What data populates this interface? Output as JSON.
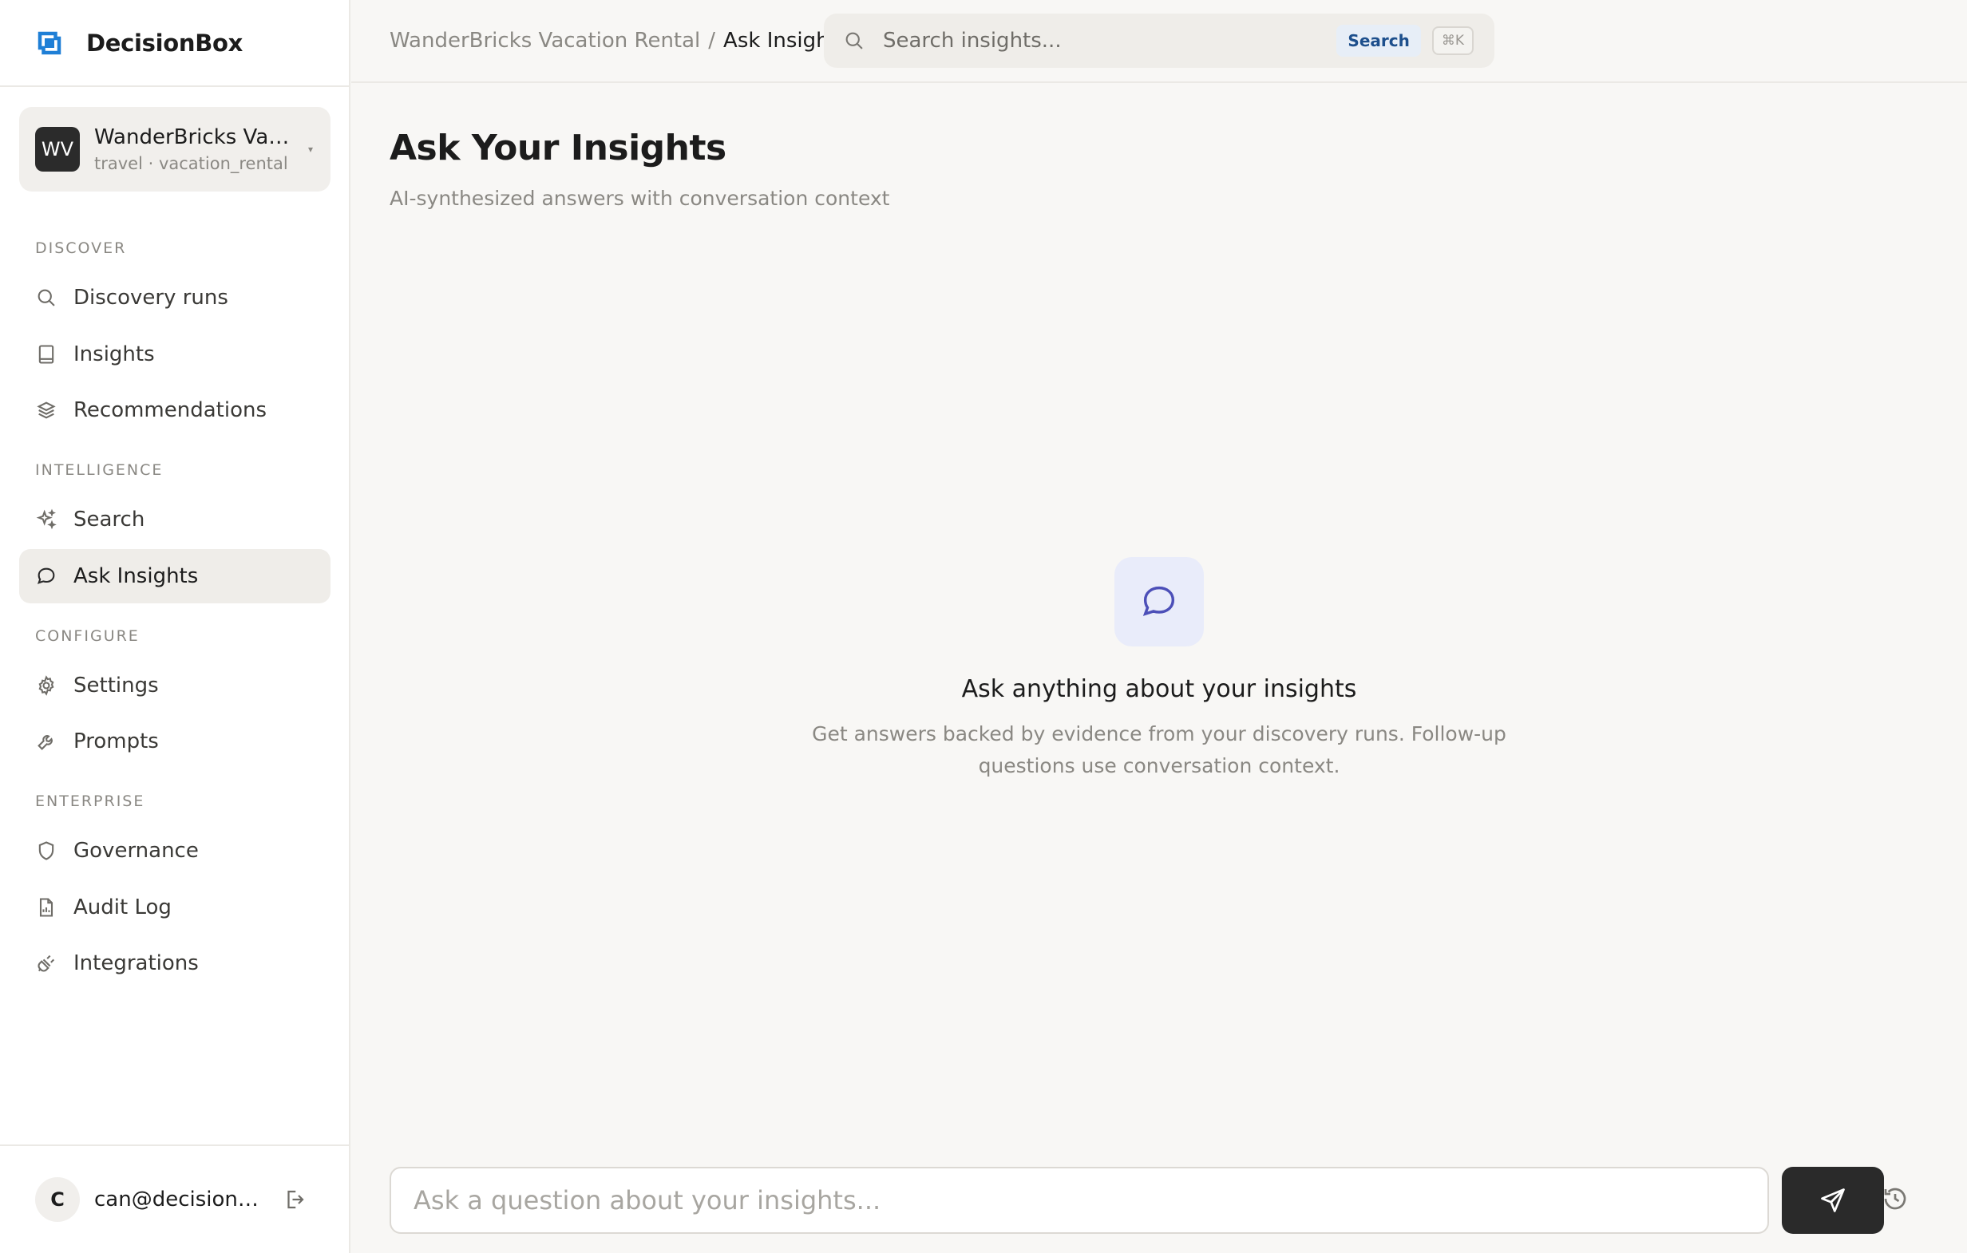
{
  "brand": {
    "name": "DecisionBox",
    "logo_icon": "decisionbox-logo-icon",
    "accent": "#1f7fd6"
  },
  "workspace": {
    "avatar": "WV",
    "name": "WanderBricks Vac...",
    "subtitle": "travel · vacation_rental",
    "caret": "▾"
  },
  "sidebar": {
    "sections": [
      {
        "label": "DISCOVER"
      },
      {
        "label": "INTELLIGENCE"
      },
      {
        "label": "CONFIGURE"
      },
      {
        "label": "ENTERPRISE"
      }
    ],
    "items": [
      {
        "label": "Discovery runs",
        "icon": "search-icon"
      },
      {
        "label": "Insights",
        "icon": "book-icon"
      },
      {
        "label": "Recommendations",
        "icon": "layers-icon"
      },
      {
        "label": "Search",
        "icon": "sparkles-icon"
      },
      {
        "label": "Ask Insights",
        "icon": "chat-bubble-icon",
        "active": true
      },
      {
        "label": "Settings",
        "icon": "gear-icon"
      },
      {
        "label": "Prompts",
        "icon": "wrench-icon"
      },
      {
        "label": "Governance",
        "icon": "shield-icon"
      },
      {
        "label": "Audit Log",
        "icon": "file-chart-icon"
      },
      {
        "label": "Integrations",
        "icon": "plug-icon"
      }
    ]
  },
  "user": {
    "initial": "C",
    "email": "can@decisionb..."
  },
  "breadcrumb": {
    "parent": "WanderBricks Vacation Rental",
    "separator": "/",
    "current": "Ask Insights"
  },
  "search": {
    "placeholder": "Search insights...",
    "button": "Search",
    "shortcut": "⌘K"
  },
  "main": {
    "title": "Ask Your Insights",
    "subtitle": "AI-synthesized answers with conversation context",
    "empty_title": "Ask anything about your insights",
    "empty_desc": "Get answers backed by evidence from your discovery runs. Follow-up questions use conversation context."
  },
  "composer": {
    "placeholder": "Ask a question about your insights..."
  }
}
